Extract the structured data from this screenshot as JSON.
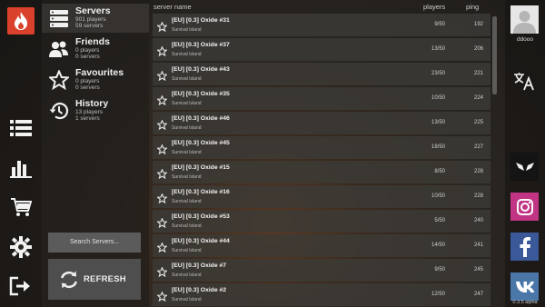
{
  "nav": {
    "items": [
      {
        "title": "Servers",
        "players": "901 players",
        "servers": "59 servers"
      },
      {
        "title": "Friends",
        "players": "0 players",
        "servers": "0 servers"
      },
      {
        "title": "Favourites",
        "players": "0 players",
        "servers": "0 servers"
      },
      {
        "title": "History",
        "players": "13 players",
        "servers": "1 servers"
      }
    ],
    "search_placeholder": "Search Servers...",
    "refresh_label": "REFRESH"
  },
  "list": {
    "headers": {
      "name": "server name",
      "players": "players",
      "ping": "ping"
    },
    "rows": [
      {
        "name": "[EU] [0.3] Oxide #31",
        "map": "Survival Island",
        "players": "9/50",
        "ping": "192"
      },
      {
        "name": "[EU] [0.3] Oxide #37",
        "map": "Survival Island",
        "players": "13/50",
        "ping": "206"
      },
      {
        "name": "[EU] [0.3] Oxide #43",
        "map": "Survival Island",
        "players": "23/50",
        "ping": "221"
      },
      {
        "name": "[EU] [0.3] Oxide #35",
        "map": "Survival Island",
        "players": "10/50",
        "ping": "224"
      },
      {
        "name": "[EU] [0.3] Oxide #46",
        "map": "Survival Island",
        "players": "13/50",
        "ping": "225"
      },
      {
        "name": "[EU] [0.3] Oxide #45",
        "map": "Survival Island",
        "players": "18/50",
        "ping": "227"
      },
      {
        "name": "[EU] [0.3] Oxide #15",
        "map": "Survival Island",
        "players": "8/50",
        "ping": "228"
      },
      {
        "name": "[EU] [0.3] Oxide #16",
        "map": "Survival Island",
        "players": "10/50",
        "ping": "228"
      },
      {
        "name": "[EU] [0.3] Oxide #53",
        "map": "Survival Island",
        "players": "5/50",
        "ping": "240"
      },
      {
        "name": "[EU] [0.3] Oxide #44",
        "map": "Survival Island",
        "players": "14/50",
        "ping": "241"
      },
      {
        "name": "[EU] [0.3] Oxide #7",
        "map": "Survival Island",
        "players": "9/50",
        "ping": "245"
      },
      {
        "name": "[EU] [0.3] Oxide #2",
        "map": "Survival Island",
        "players": "12/50",
        "ping": "247"
      }
    ]
  },
  "user": {
    "name": "ddooo"
  },
  "version": "0.3.5 alpha",
  "colors": {
    "logo": "#d9412c",
    "instagram": "#c13584",
    "facebook": "#3b5998",
    "vk": "#4a76a8"
  }
}
